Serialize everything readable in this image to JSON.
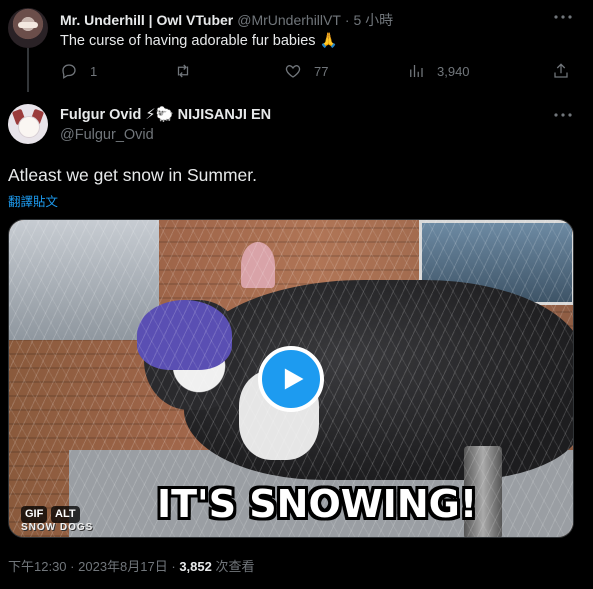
{
  "reply_tweet": {
    "name": "Mr. Underhill | Owl VTuber",
    "handle": "@MrUnderhillVT",
    "time": "· 5 小時",
    "text": "The curse of having adorable fur babies 🙏",
    "actions": {
      "replies": "1",
      "retweets": "",
      "likes": "77",
      "views": "3,940"
    }
  },
  "main_tweet": {
    "name": "Fulgur Ovid ⚡🐑 NIJISANJI EN",
    "handle": "@Fulgur_Ovid",
    "text": "Atleast we get snow in Summer.",
    "translate_label": "翻譯貼文",
    "media": {
      "caption": "IT'S SNOWING!",
      "gif_badge": "GIF",
      "alt_badge": "ALT",
      "watermark": "SNOW DOGS"
    },
    "time": "下午12:30",
    "date": "2023年8月17日",
    "views_count": "3,852",
    "views_label": "次查看"
  },
  "icons": [
    "more-icon",
    "reply-icon",
    "retweet-icon",
    "like-icon",
    "views-icon",
    "share-icon",
    "play-icon"
  ],
  "colors": {
    "background": "#000000",
    "text": "#e7e9ea",
    "secondary": "#71767b",
    "accent": "#1d9bf0"
  }
}
